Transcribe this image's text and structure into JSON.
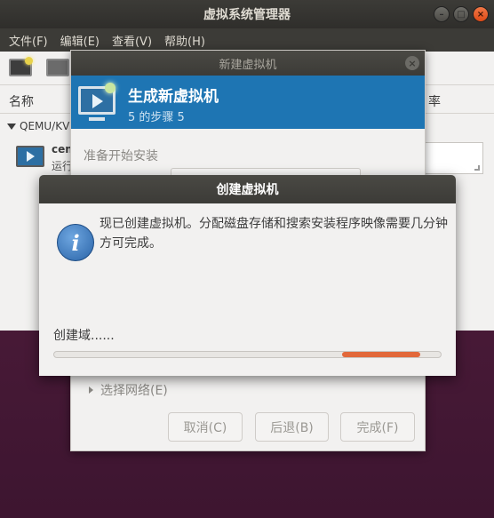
{
  "main_window": {
    "title": "虚拟系统管理器",
    "menu": [
      "文件(F)",
      "编辑(E)",
      "查看(V)",
      "帮助(H)"
    ],
    "columns": {
      "name": "名称",
      "rate": "率"
    },
    "group": "QEMU/KV",
    "vm": {
      "name": "cen",
      "status": "运行"
    }
  },
  "wizard": {
    "title": "新建虚拟机",
    "header_title": "生成新虚拟机",
    "header_step": "5 的步骤 5",
    "section_label": "准备开始安装",
    "network_expander": "选择网络(E)",
    "buttons": {
      "cancel": "取消(C)",
      "back": "后退(B)",
      "finish": "完成(F)"
    }
  },
  "progress_dialog": {
    "title": "创建虚拟机",
    "message": "现已创建虚拟机。分配磁盘存储和搜索安装程序映像需要几分钟方可完成。",
    "status": "创建域......"
  },
  "icons": {
    "window_controls": [
      "minimize-icon",
      "maximize-icon",
      "close-icon"
    ],
    "info": "info-icon"
  },
  "colors": {
    "wizard_header": "#1e75b3",
    "progress_fill": "#e2683a",
    "titlebar": "#3c3b37"
  }
}
